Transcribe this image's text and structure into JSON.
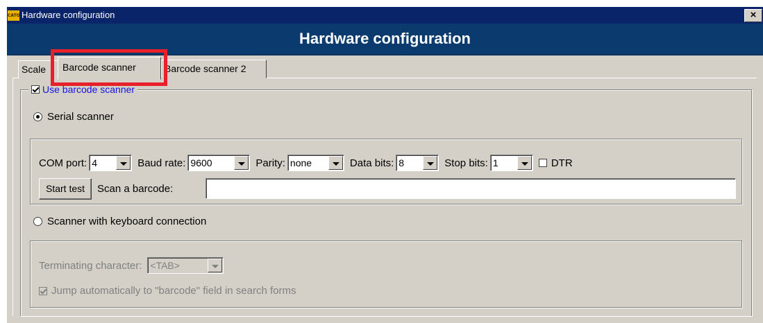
{
  "window": {
    "title": "Hardware configuration",
    "app_icon_text": "CATO",
    "close_label": "×"
  },
  "header": {
    "title": "Hardware configuration"
  },
  "tabs": [
    {
      "label": "Scale",
      "selected": false
    },
    {
      "label": "Barcode scanner",
      "selected": true
    },
    {
      "label": "Barcode scanner 2",
      "selected": false
    }
  ],
  "barcode_group": {
    "use_label": "Use barcode scanner",
    "use_checked": true,
    "serial_label": "Serial scanner",
    "serial_selected": true,
    "com_port": {
      "label": "COM port:",
      "value": "4"
    },
    "baud_rate": {
      "label": "Baud rate:",
      "value": "9600"
    },
    "parity": {
      "label": "Parity:",
      "value": "none"
    },
    "data_bits": {
      "label": "Data bits:",
      "value": "8"
    },
    "stop_bits": {
      "label": "Stop bits:",
      "value": "1"
    },
    "dtr": {
      "label": "DTR",
      "checked": false
    },
    "start_test_label": "Start test",
    "scan_label": "Scan a barcode:",
    "scan_value": "",
    "keyboard_label": "Scanner with keyboard connection",
    "keyboard_selected": false,
    "terminating": {
      "label": "Terminating character:",
      "value": "<TAB>"
    },
    "jump": {
      "label": "Jump automatically to \"barcode\" field in search forms",
      "checked": true
    }
  },
  "colors": {
    "titlebar": "#0a246a",
    "banner": "#0a3a6e",
    "face": "#d4d0c8",
    "highlight": "#e8202a",
    "link_text": "#1414e6"
  }
}
